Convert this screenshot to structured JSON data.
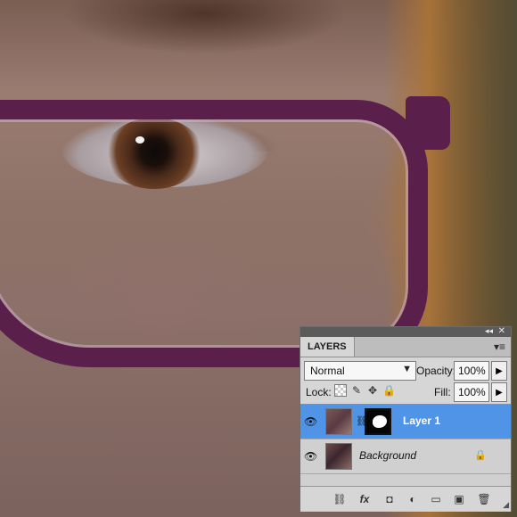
{
  "layers_panel": {
    "tab_label": "LAYERS",
    "blend_mode": "Normal",
    "opacity_label": "Opacity:",
    "opacity_value": "100%",
    "lock_label": "Lock:",
    "fill_label": "Fill:",
    "fill_value": "100%",
    "layers": [
      {
        "name": "Layer 1",
        "visible": true,
        "selected": true
      },
      {
        "name": "Background",
        "visible": true,
        "locked": true
      }
    ],
    "icons": {
      "collapse": "double-left-arrow-icon",
      "close": "close-icon",
      "panel_menu": "panel-menu-icon",
      "blend_chevron": "chevron-down-icon",
      "arrow": "arrow-right-icon",
      "footer": [
        "link-layers-icon",
        "fx-icon",
        "add-mask-icon",
        "adjustment-layer-icon",
        "group-icon",
        "new-layer-icon",
        "delete-icon"
      ]
    }
  },
  "colors": {
    "selected_row": "#4f94e6",
    "panel_bg": "#d6d6d6",
    "frame": "#5a1f4b"
  }
}
